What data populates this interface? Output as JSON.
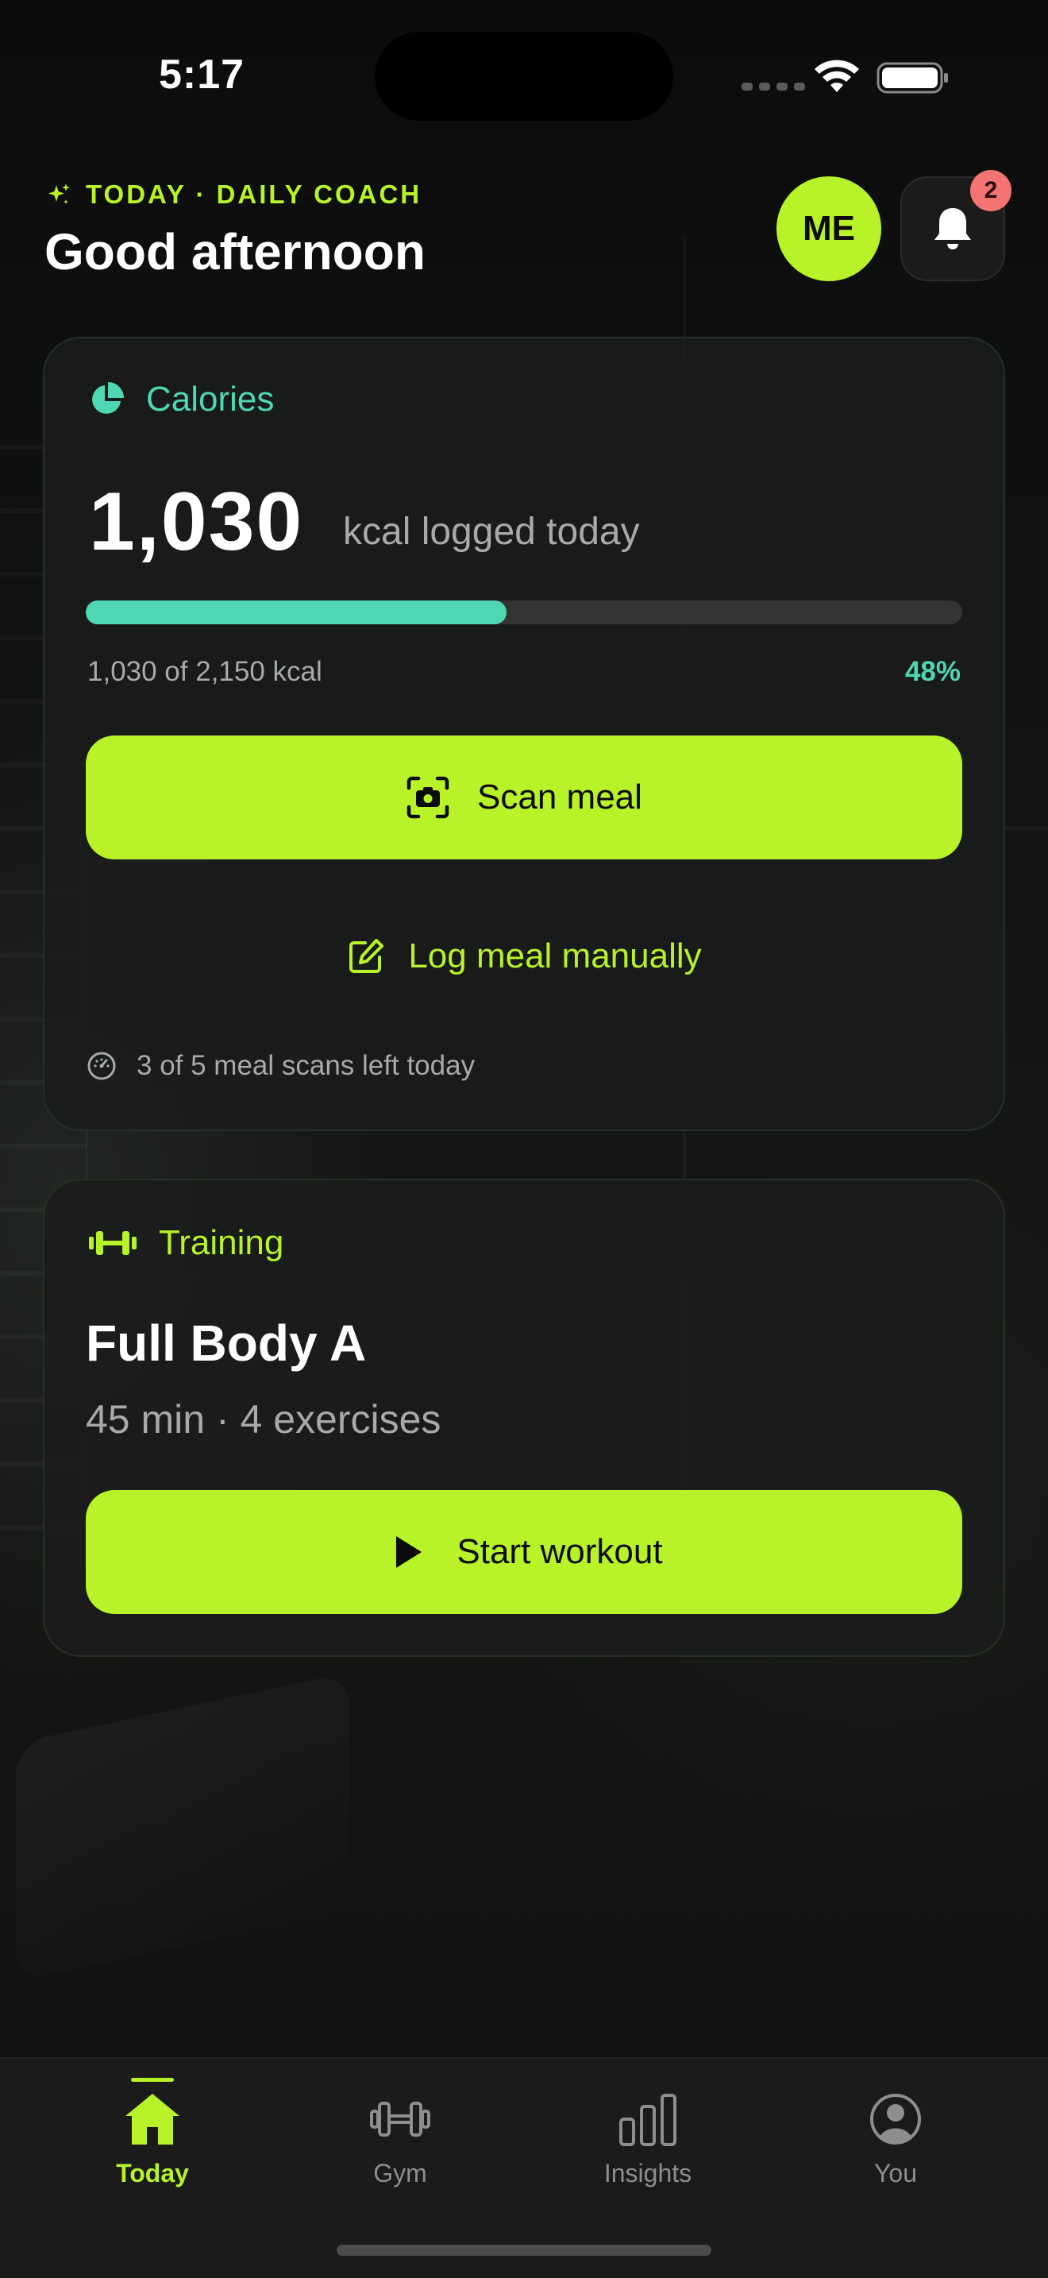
{
  "status_bar": {
    "time": "5:17"
  },
  "header": {
    "eyebrow": "TODAY · DAILY COACH",
    "greeting": "Good afternoon",
    "avatar_initials": "ME",
    "notification_count": "2"
  },
  "calories": {
    "title": "Calories",
    "logged_value": "1,030",
    "logged_suffix": "kcal logged today",
    "progress_fraction": 0.48,
    "progress_caption": "1,030 of 2,150 kcal",
    "progress_percent": "48%",
    "scan_button": "Scan meal",
    "log_manual_link": "Log meal manually",
    "scans_left": "3 of 5 meal scans left today"
  },
  "training": {
    "title": "Training",
    "workout_name": "Full Body A",
    "workout_meta": "45 min · 4 exercises",
    "start_button": "Start workout"
  },
  "tab_bar": {
    "items": [
      {
        "label": "Today",
        "icon": "home-icon",
        "active": true
      },
      {
        "label": "Gym",
        "icon": "dumbbell-icon",
        "active": false
      },
      {
        "label": "Insights",
        "icon": "bar-chart-icon",
        "active": false
      },
      {
        "label": "You",
        "icon": "person-icon",
        "active": false
      }
    ]
  },
  "colors": {
    "accent": "#b8f229",
    "calories_accent": "#4fd6b3",
    "badge": "#f47474",
    "background": "#0d0e0d",
    "card": "#1a1c1b"
  }
}
